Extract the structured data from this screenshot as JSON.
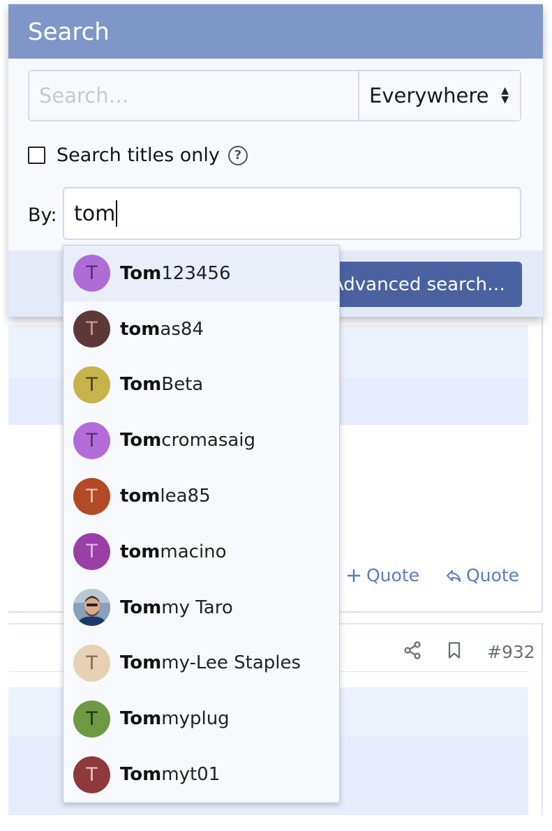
{
  "search_menu": {
    "title": "Search",
    "search_placeholder": "Search…",
    "scope_selected": "Everywhere",
    "titles_only_label": "Search titles only",
    "by_label": "By:",
    "by_value": "tom",
    "advanced_button": "Advanced search…"
  },
  "autocomplete": {
    "items": [
      {
        "match": "Tom",
        "rest": "123456",
        "initial": "T",
        "avatar_color": "#b06cd6",
        "text_color": "#5a2c78"
      },
      {
        "match": "tom",
        "rest": "as84",
        "initial": "T",
        "avatar_color": "#5e3838",
        "text_color": "#c99a9a"
      },
      {
        "match": "Tom",
        "rest": "Beta",
        "initial": "T",
        "avatar_color": "#c7b24c",
        "text_color": "#4c4216"
      },
      {
        "match": "Tom",
        "rest": "cromasaig",
        "initial": "T",
        "avatar_color": "#b46cd8",
        "text_color": "#5a2c78"
      },
      {
        "match": "tom",
        "rest": "lea85",
        "initial": "T",
        "avatar_color": "#b24a25",
        "text_color": "#f0c2b0"
      },
      {
        "match": "tom",
        "rest": "macino",
        "initial": "T",
        "avatar_color": "#9b3fa8",
        "text_color": "#e2b3ea"
      },
      {
        "match": "Tom",
        "rest": "my Taro",
        "initial": "",
        "avatar_color": "#6b7a8c",
        "text_color": "#ffffff",
        "photo": true
      },
      {
        "match": "Tom",
        "rest": "my-Lee Staples",
        "initial": "T",
        "avatar_color": "#e8d0b4",
        "text_color": "#8a6a48"
      },
      {
        "match": "Tom",
        "rest": "myplug",
        "initial": "T",
        "avatar_color": "#6d9a42",
        "text_color": "#1f3310"
      },
      {
        "match": "Tom",
        "rest": "myt01",
        "initial": "T",
        "avatar_color": "#8e3a3a",
        "text_color": "#efbcbc"
      }
    ]
  },
  "background": {
    "quote_label_1": "Quote",
    "quote_label_2": "Quote",
    "post_number": "#932"
  },
  "icons": {
    "help": "question-circle-icon",
    "plus": "plus-icon",
    "reply": "reply-icon",
    "share": "share-icon",
    "bookmark": "bookmark-icon"
  }
}
